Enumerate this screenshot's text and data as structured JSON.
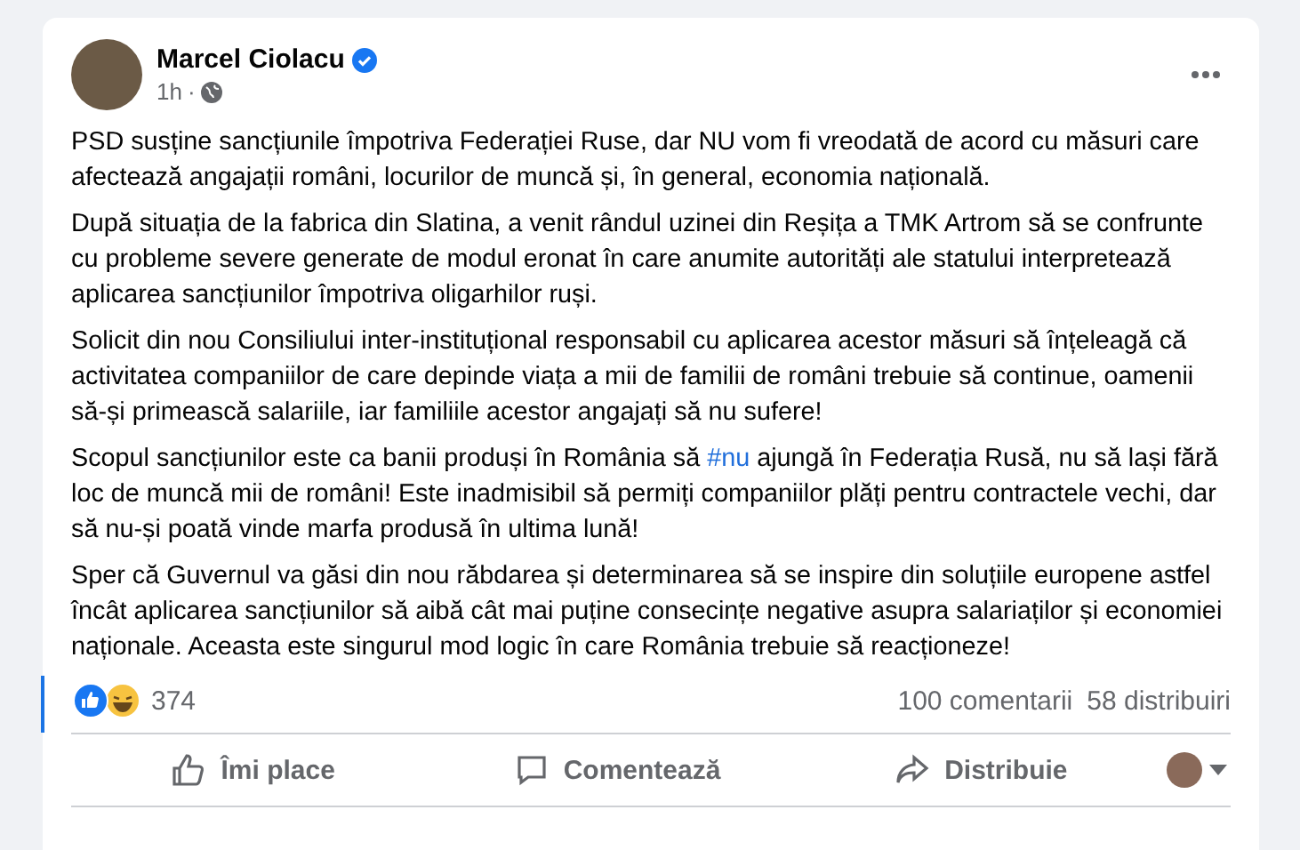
{
  "post": {
    "author": "Marcel Ciolacu",
    "verified": true,
    "time": "1h",
    "time_separator": "·",
    "paragraphs": [
      [
        {
          "kind": "text",
          "text": "PSD susține sancțiunile împotriva Federației Ruse, dar NU vom fi vreodată de acord cu măsuri care afectează angajații români, locurilor de muncă și, în general, economia națională."
        }
      ],
      [
        {
          "kind": "text",
          "text": "După situația de la fabrica din Slatina, a venit rândul uzinei din Reșița a TMK Artrom să se confrunte cu probleme severe generate de modul eronat în care anumite autorități ale statului interpretează aplicarea sancțiunilor împotriva oligarhilor ruși."
        }
      ],
      [
        {
          "kind": "text",
          "text": "Solicit din nou Consiliului inter-instituțional responsabil cu aplicarea acestor măsuri să înțeleagă că activitatea companiilor de care depinde viața a mii de familii de români trebuie să continue, oamenii să-și primească salariile, iar familiile acestor angajați să nu sufere!"
        }
      ],
      [
        {
          "kind": "text",
          "text": "Scopul sancțiunilor este ca banii produși în România să "
        },
        {
          "kind": "hashtag",
          "text": "#nu"
        },
        {
          "kind": "text",
          "text": " ajungă în Federația Rusă, nu să lași fără loc de muncă mii de români! Este inadmisibil să permiți companiilor plăți pentru contractele vechi, dar să nu-și poată vinde marfa produsă în ultima lună!"
        }
      ],
      [
        {
          "kind": "text",
          "text": "Sper că Guvernul va găsi din nou răbdarea și determinarea să se inspire din soluțiile europene astfel încât aplicarea sancțiunilor să aibă cât mai puține consecințe negative asupra salariaților și economiei naționale. Aceasta este singurul mod logic în care România trebuie să reacționeze!"
        }
      ]
    ],
    "reaction_count": "374",
    "comments": "100 comentarii",
    "shares": "58 distribuiri",
    "actions": [
      {
        "kind": "like",
        "label": "Îmi place"
      },
      {
        "kind": "comment",
        "label": "Comentează"
      },
      {
        "kind": "share",
        "label": "Distribuie"
      }
    ]
  }
}
